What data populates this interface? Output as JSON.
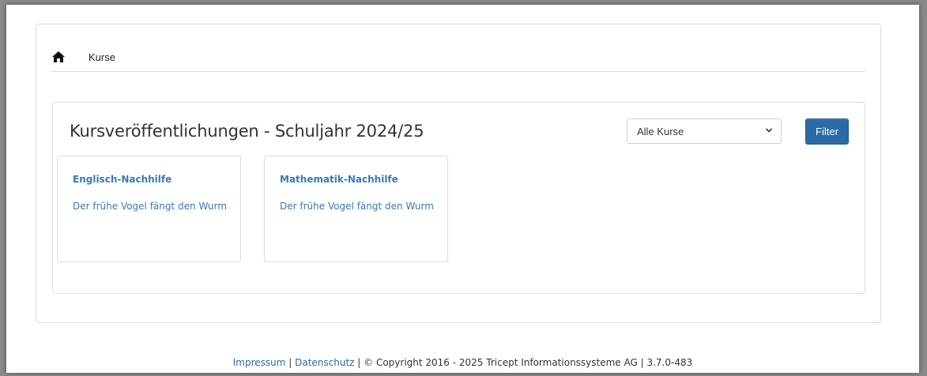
{
  "breadcrumb": {
    "home_icon": "home-icon",
    "current": "Kurse"
  },
  "main": {
    "title": "Kursveröffentlichungen - Schuljahr 2024/25",
    "filter_select": {
      "selected": "Alle Kurse"
    },
    "filter_button": "Filter",
    "courses": [
      {
        "title": "Englisch-Nachhilfe",
        "subtitle": "Der frühe Vogel fängt den Wurm"
      },
      {
        "title": "Mathematik-Nachhilfe",
        "subtitle": "Der frühe Vogel fängt den Wurm"
      }
    ]
  },
  "footer": {
    "impressum": "Impressum",
    "sep1": " | ",
    "datenschutz": "Datenschutz",
    "copyright": " | © Copyright 2016 - 2025 Tricept Informationssysteme AG | 3.7.0-483"
  },
  "colors": {
    "accent": "#2a6aa6",
    "link": "#3a79b8"
  }
}
